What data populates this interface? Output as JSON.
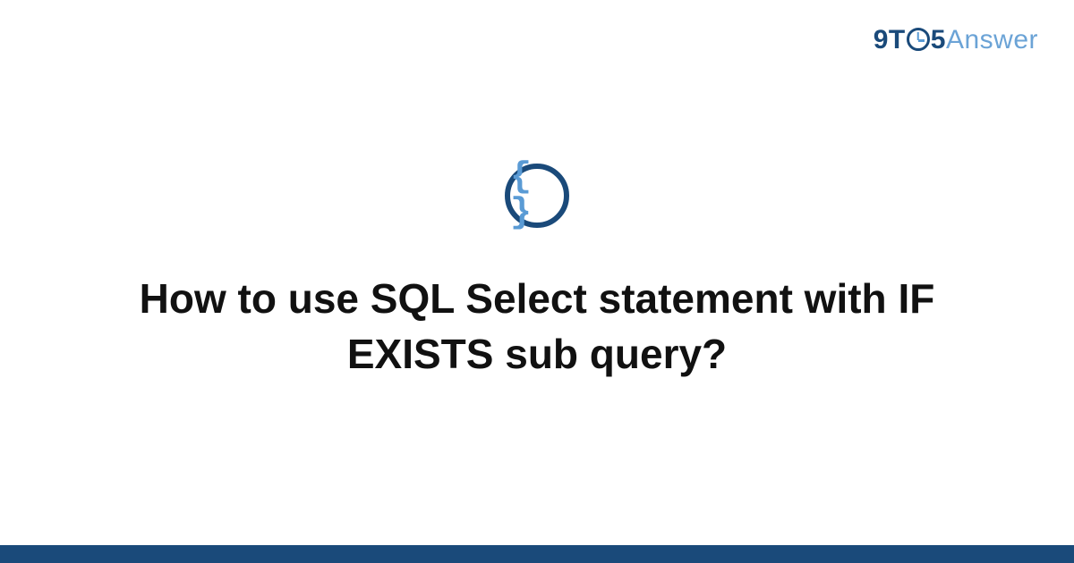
{
  "logo": {
    "part1": "9T",
    "part2": "5",
    "part3": "Answer"
  },
  "icon": {
    "braces": "{ }"
  },
  "title": "How to use SQL Select statement with IF EXISTS sub query?",
  "colors": {
    "dark_blue": "#1a4a7a",
    "light_blue": "#5a9bd5",
    "answer_blue": "#6ba3d6"
  }
}
